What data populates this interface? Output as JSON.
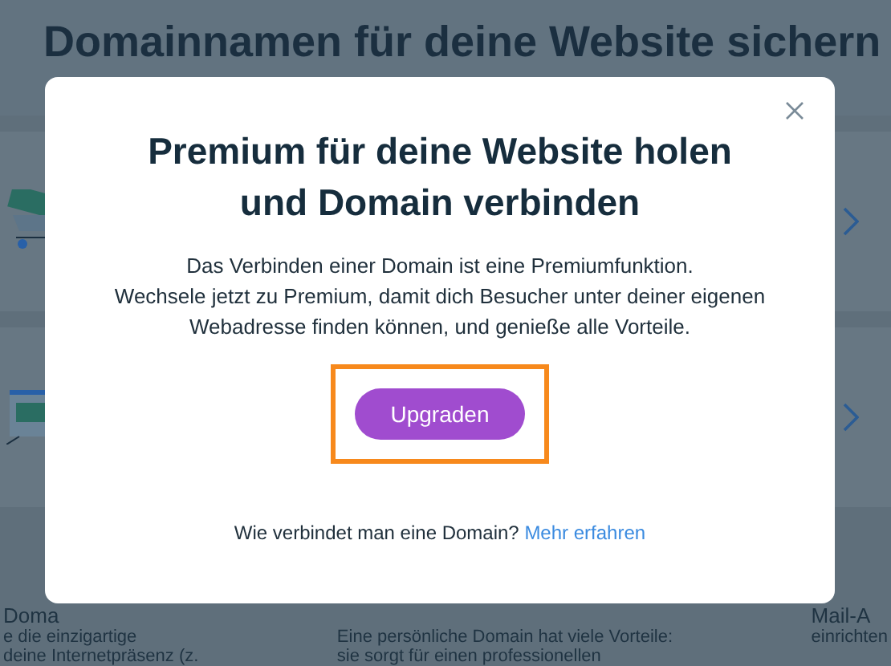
{
  "page": {
    "title": "Domainnamen für deine Website sichern"
  },
  "cards": [
    {
      "kind": "cart"
    },
    {
      "kind": "browser"
    }
  ],
  "features": [
    {
      "heading": "Doma",
      "lines": [
        "e die einzigartige",
        "deine Internetpräsenz (z."
      ]
    },
    {
      "lines": [
        "Eine persönliche Domain hat viele Vorteile:",
        "sie sorgt für einen professionellen"
      ]
    },
    {
      "heading": "Mail-A",
      "lines": [
        "einrichten"
      ]
    }
  ],
  "dialog": {
    "title": "Premium für deine Website holen und Domain verbinden",
    "body": [
      "Das Verbinden einer Domain ist eine Premiumfunktion.",
      "Wechsele jetzt zu Premium, damit dich Besucher unter deiner eigenen",
      "Webadresse finden können, und genieße alle Vorteile."
    ],
    "button": "Upgraden",
    "button_highlighted": true,
    "footer_text": "Wie verbindet man eine Domain?",
    "footer_link": "Mehr erfahren"
  }
}
